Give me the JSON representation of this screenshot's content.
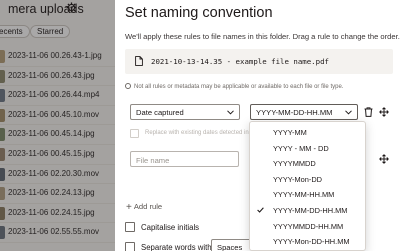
{
  "background": {
    "title": "mera uploads",
    "tabs": [
      "ecents",
      "Starred"
    ],
    "files": [
      {
        "name": "2023-11-06 00.26.43-1.jpg",
        "thumb": "#b7a07a"
      },
      {
        "name": "2023-11-06 00.26.43.jpg",
        "thumb": "#8f8b6e"
      },
      {
        "name": "2023-11-06 00.26.44.mp4",
        "thumb": "#6e7a88"
      },
      {
        "name": "2023-11-06 00.45.10.mov",
        "thumb": "#a48f6a"
      },
      {
        "name": "2023-11-06 00.45.14.jpg",
        "thumb": "#7c8c6a"
      },
      {
        "name": "2023-11-06 00.45.15.jpg",
        "thumb": "#9a8670"
      },
      {
        "name": "2023-11-06 02.20.30.mov",
        "thumb": "#5f6a74"
      },
      {
        "name": "2023-11-06 02.24.13.jpg",
        "thumb": "#b2a184"
      },
      {
        "name": "2023-11-06 02.24.15.jpg",
        "thumb": "#8c7c62"
      },
      {
        "name": "2023-11-06 02.55.55.mov",
        "thumb": "#6b7480"
      }
    ]
  },
  "modal": {
    "title": "Set naming convention",
    "description": "We'll apply these rules to file names in this folder. Drag a rule to change the order.",
    "example": "2021-10-13-14.35 - example file name.pdf",
    "note": "Not all rules or metadata may be applicable or available to each file or file type.",
    "rule1": {
      "field": "Date captured",
      "format": "YYYY-MM-DD-HH.MM",
      "replace_label": "Replace with existing dates detected in file name"
    },
    "rule2": {
      "placeholder": "File name"
    },
    "add_rule_label": "Add rule",
    "capitalise_label": "Capitalise initials",
    "separate_label": "Separate words with",
    "separator_value": "Spaces"
  },
  "format_menu": {
    "options": [
      "YYYY-MM",
      "YYYY - MM - DD",
      "YYYYMMDD",
      "YYYY-Mon-DD",
      "YYYY-MM-HH.MM",
      "YYYY-MM-DD-HH.MM",
      "YYYYMMDD-HH.MM",
      "YYYY-Mon-DD-HH.MM"
    ],
    "selected_index": 5
  },
  "colors": {
    "text": "#1e1919",
    "border": "#8f8a85",
    "overlay": "rgba(30,25,25,0.38)"
  }
}
